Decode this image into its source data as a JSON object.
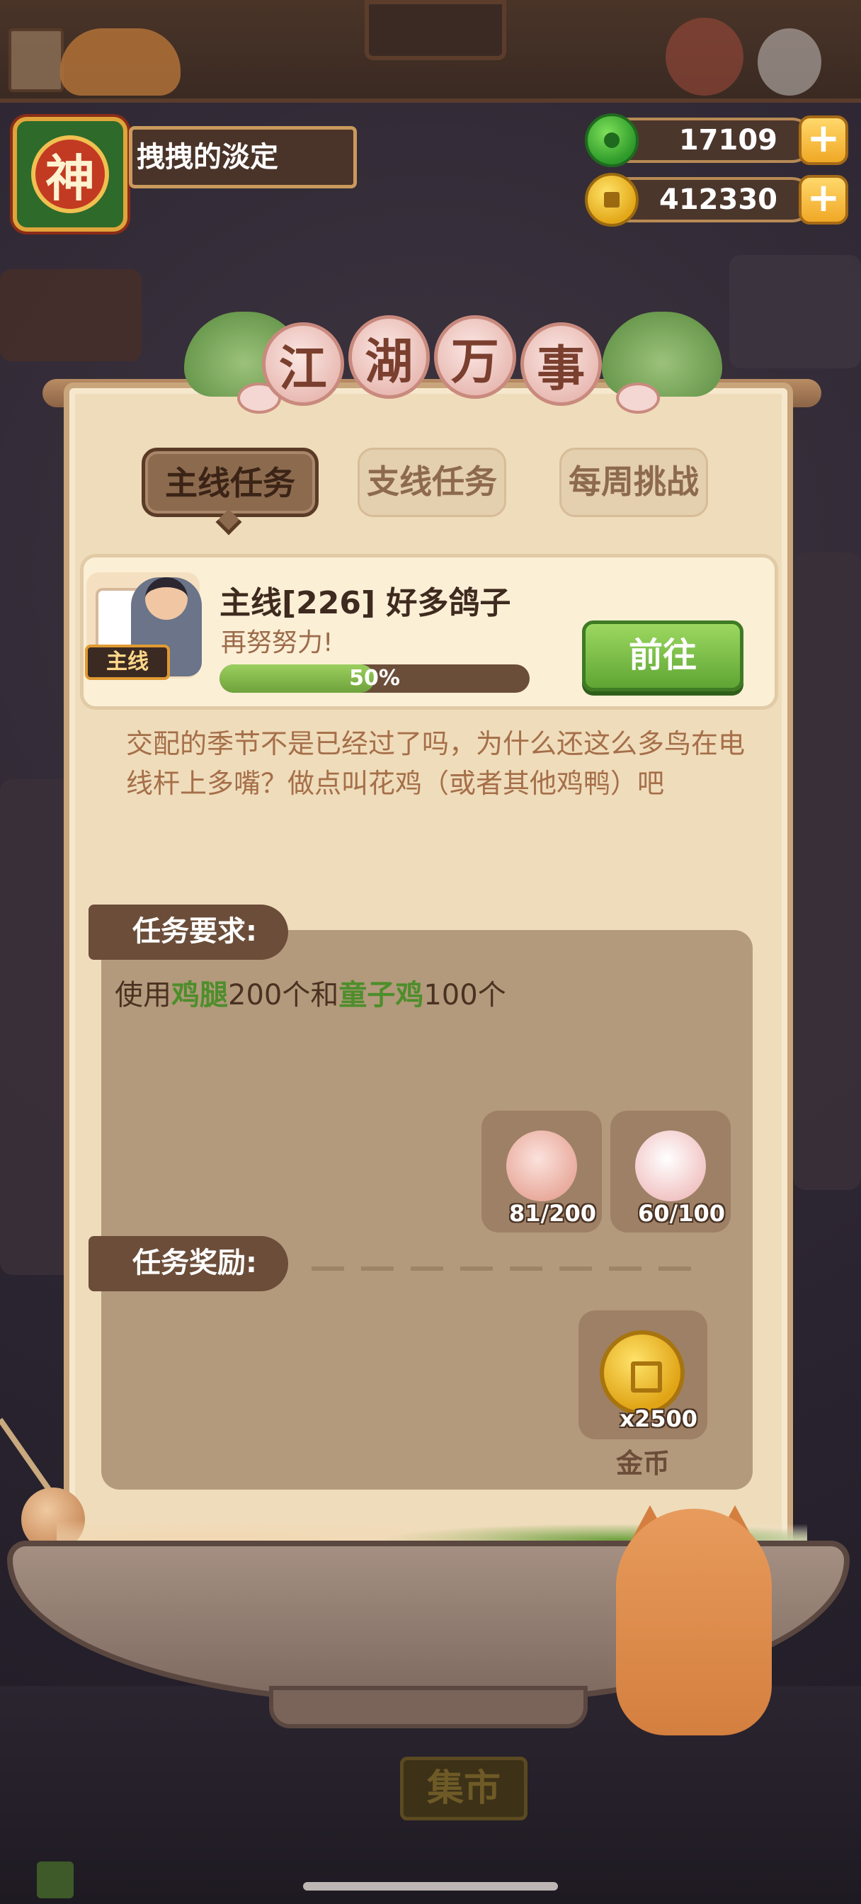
{
  "player": {
    "avatar_glyph": "神",
    "name": "拽拽的淡定"
  },
  "resources": {
    "jade": {
      "icon": "jade-coin-icon",
      "value": "17109",
      "plus": "+"
    },
    "gold": {
      "icon": "gold-coin-icon",
      "value": "412330",
      "plus": "+"
    }
  },
  "background": {
    "market_sign": "集市"
  },
  "panel": {
    "title_chars": [
      "江",
      "湖",
      "万",
      "事"
    ],
    "tabs": [
      {
        "label": "主线任务",
        "active": true
      },
      {
        "label": "支线任务",
        "active": false
      },
      {
        "label": "每周挑战",
        "active": false
      }
    ]
  },
  "quest": {
    "tag": "主线",
    "title": "主线[226] 好多鸽子",
    "subtitle": "再努努力!",
    "progress_percent": 50,
    "progress_label": "50%",
    "go_button": "前往",
    "description": "交配的季节不是已经过了吗，为什么还这么多鸟在电线杆上多嘴？做点叫花鸡（或者其他鸡鸭）吧"
  },
  "requirements": {
    "header": "任务要求:",
    "text_prefix": "使用",
    "item1_name": "鸡腿",
    "item1_qty": "200个和",
    "item2_name": "童子鸡",
    "item2_qty": "100个",
    "items": [
      {
        "icon": "chicken-leg-icon",
        "count": "81/200"
      },
      {
        "icon": "young-chicken-icon",
        "count": "60/100"
      }
    ]
  },
  "rewards": {
    "header": "任务奖励:",
    "items": [
      {
        "icon": "gold-coin-icon",
        "amount": "x2500",
        "label": "金币"
      }
    ]
  },
  "colors": {
    "panel_bg": "#efdcbb",
    "accent_green": "#5fa534",
    "highlight_green": "#4d8e2b",
    "dark_brown": "#6b4d39",
    "gold": "#e0a416"
  }
}
